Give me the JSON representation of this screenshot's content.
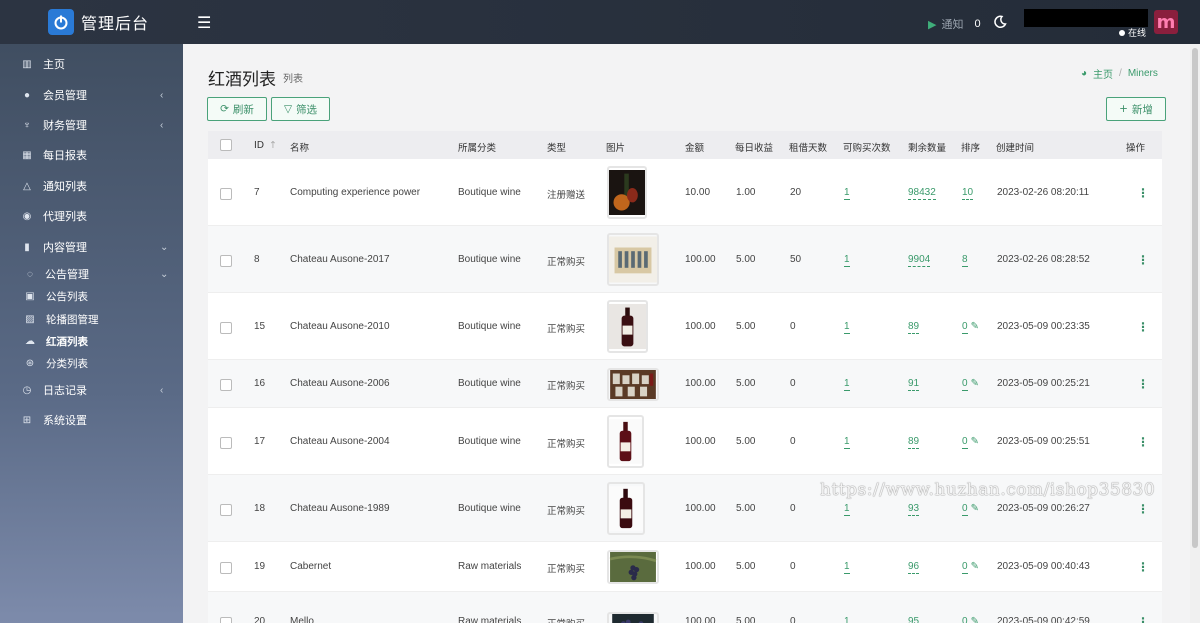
{
  "app": {
    "title": "管理后台"
  },
  "topbar": {
    "notify_label": "通知",
    "notify_count": "0",
    "online_label": "在线",
    "avatar_letter": "m"
  },
  "sidebar": {
    "items": [
      {
        "label": "主页",
        "icon": "chart-icon"
      },
      {
        "label": "会员管理",
        "icon": "user-icon",
        "arrow": "‹"
      },
      {
        "label": "财务管理",
        "icon": "finance-icon",
        "arrow": "‹"
      },
      {
        "label": "每日报表",
        "icon": "calendar-icon"
      },
      {
        "label": "通知列表",
        "icon": "bell-icon"
      },
      {
        "label": "代理列表",
        "icon": "agent-icon"
      },
      {
        "label": "内容管理",
        "icon": "bookmark-icon",
        "arrow": "⌄"
      },
      {
        "label": "公告管理",
        "icon": "chat-icon",
        "arrow": "⌄"
      },
      {
        "label": "公告列表",
        "icon": "notice-icon"
      },
      {
        "label": "轮播图管理",
        "icon": "image-icon"
      },
      {
        "label": "红酒列表",
        "icon": "cloud-icon"
      },
      {
        "label": "分类列表",
        "icon": "category-icon"
      },
      {
        "label": "日志记录",
        "icon": "clock-icon",
        "arrow": "‹"
      },
      {
        "label": "系统设置",
        "icon": "windows-icon"
      }
    ]
  },
  "page": {
    "title": "红酒列表",
    "subtitle": "列表",
    "breadcrumb_home": "主页",
    "breadcrumb_sep": "/",
    "breadcrumb_current": "Miners"
  },
  "toolbar": {
    "refresh_label": "刷新",
    "filter_label": "筛选",
    "add_label": "新增"
  },
  "table": {
    "columns": [
      "ID",
      "名称",
      "所属分类",
      "类型",
      "图片",
      "金额",
      "每日收益",
      "租借天数",
      "可购买次数",
      "剩余数量",
      "排序",
      "创建时间",
      "操作"
    ],
    "rows": [
      {
        "id": "7",
        "name": "Computing experience power",
        "category": "Boutique wine",
        "type": "注册赠送",
        "amount": "10.00",
        "daily": "1.00",
        "days": "20",
        "times": "1",
        "remain": "98432",
        "sort": "10",
        "created": "2023-02-26 08:20:11"
      },
      {
        "id": "8",
        "name": "Chateau Ausone-2017",
        "category": "Boutique wine",
        "type": "正常购买",
        "amount": "100.00",
        "daily": "5.00",
        "days": "50",
        "times": "1",
        "remain": "9904",
        "sort": "8",
        "created": "2023-02-26 08:28:52"
      },
      {
        "id": "15",
        "name": "Chateau Ausone-2010",
        "category": "Boutique wine",
        "type": "正常购买",
        "amount": "100.00",
        "daily": "5.00",
        "days": "0",
        "times": "1",
        "remain": "89",
        "sort": "0",
        "created": "2023-05-09 00:23:35"
      },
      {
        "id": "16",
        "name": "Chateau Ausone-2006",
        "category": "Boutique wine",
        "type": "正常购买",
        "amount": "100.00",
        "daily": "5.00",
        "days": "0",
        "times": "1",
        "remain": "91",
        "sort": "0",
        "created": "2023-05-09 00:25:21"
      },
      {
        "id": "17",
        "name": "Chateau Ausone-2004",
        "category": "Boutique wine",
        "type": "正常购买",
        "amount": "100.00",
        "daily": "5.00",
        "days": "0",
        "times": "1",
        "remain": "89",
        "sort": "0",
        "created": "2023-05-09 00:25:51"
      },
      {
        "id": "18",
        "name": "Chateau Ausone-1989",
        "category": "Boutique wine",
        "type": "正常购买",
        "amount": "100.00",
        "daily": "5.00",
        "days": "0",
        "times": "1",
        "remain": "93",
        "sort": "0",
        "created": "2023-05-09 00:26:27"
      },
      {
        "id": "19",
        "name": "Cabernet",
        "category": "Raw materials",
        "type": "正常购买",
        "amount": "100.00",
        "daily": "5.00",
        "days": "0",
        "times": "1",
        "remain": "96",
        "sort": "0",
        "created": "2023-05-09 00:40:43"
      },
      {
        "id": "20",
        "name": "Mello",
        "category": "Raw materials",
        "type": "正常购买",
        "amount": "100.00",
        "daily": "5.00",
        "days": "0",
        "times": "1",
        "remain": "95",
        "sort": "0",
        "created": "2023-05-09 00:42:59"
      }
    ]
  },
  "watermark": "https://www.huzhan.com/ishop35830"
}
